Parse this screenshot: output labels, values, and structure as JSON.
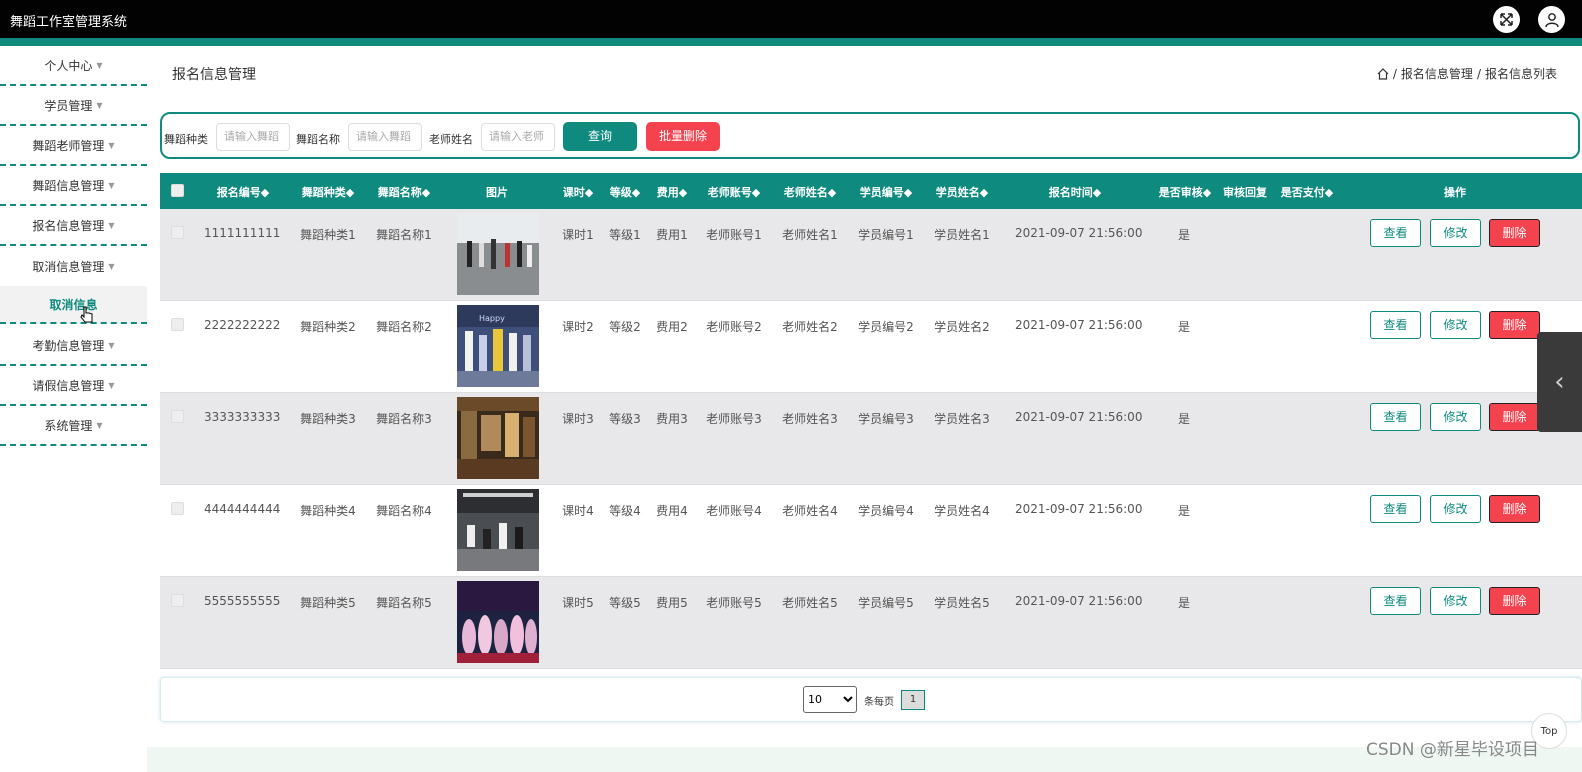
{
  "app": {
    "title": "舞蹈工作室管理系统"
  },
  "sidebar": {
    "items": [
      {
        "label": "个人中心"
      },
      {
        "label": "学员管理"
      },
      {
        "label": "舞蹈老师管理"
      },
      {
        "label": "舞蹈信息管理"
      },
      {
        "label": "报名信息管理"
      },
      {
        "label": "取消信息管理"
      },
      {
        "label": "考勤信息管理"
      },
      {
        "label": "请假信息管理"
      },
      {
        "label": "系统管理"
      }
    ],
    "sub_item": {
      "label": "取消信息"
    }
  },
  "header": {
    "page_title": "报名信息管理",
    "breadcrumb": [
      "报名信息管理",
      "报名信息列表"
    ],
    "separator": "/"
  },
  "search": {
    "fields": [
      {
        "label": "舞蹈种类",
        "placeholder": "请输入舞蹈"
      },
      {
        "label": "舞蹈名称",
        "placeholder": "请输入舞蹈"
      },
      {
        "label": "老师姓名",
        "placeholder": "请输入老师"
      }
    ],
    "query_label": "查询",
    "bulk_delete_label": "批量删除"
  },
  "table": {
    "columns": [
      "报名编号◆",
      "舞蹈种类◆",
      "舞蹈名称◆",
      "图片",
      "课时◆",
      "等级◆",
      "费用◆",
      "老师账号◆",
      "老师姓名◆",
      "学员编号◆",
      "学员姓名◆",
      "报名时间◆",
      "是否审核◆",
      "审核回复",
      "是否支付◆",
      "操作"
    ],
    "rows": [
      {
        "id": "1111111111",
        "kind": "舞蹈种类1",
        "name": "舞蹈名称1",
        "hours": "课时1",
        "level": "等级1",
        "fee": "费用1",
        "teacher_account": "老师账号1",
        "teacher_name": "老师姓名1",
        "student_no": "学员编号1",
        "student_name": "学员姓名1",
        "time": "2021-09-07 21:56:00",
        "reviewed": "是",
        "reply": "",
        "paid": ""
      },
      {
        "id": "2222222222",
        "kind": "舞蹈种类2",
        "name": "舞蹈名称2",
        "hours": "课时2",
        "level": "等级2",
        "fee": "费用2",
        "teacher_account": "老师账号2",
        "teacher_name": "老师姓名2",
        "student_no": "学员编号2",
        "student_name": "学员姓名2",
        "time": "2021-09-07 21:56:00",
        "reviewed": "是",
        "reply": "",
        "paid": ""
      },
      {
        "id": "3333333333",
        "kind": "舞蹈种类3",
        "name": "舞蹈名称3",
        "hours": "课时3",
        "level": "等级3",
        "fee": "费用3",
        "teacher_account": "老师账号3",
        "teacher_name": "老师姓名3",
        "student_no": "学员编号3",
        "student_name": "学员姓名3",
        "time": "2021-09-07 21:56:00",
        "reviewed": "是",
        "reply": "",
        "paid": ""
      },
      {
        "id": "4444444444",
        "kind": "舞蹈种类4",
        "name": "舞蹈名称4",
        "hours": "课时4",
        "level": "等级4",
        "fee": "费用4",
        "teacher_account": "老师账号4",
        "teacher_name": "老师姓名4",
        "student_no": "学员编号4",
        "student_name": "学员姓名4",
        "time": "2021-09-07 21:56:00",
        "reviewed": "是",
        "reply": "",
        "paid": ""
      },
      {
        "id": "5555555555",
        "kind": "舞蹈种类5",
        "name": "舞蹈名称5",
        "hours": "课时5",
        "level": "等级5",
        "fee": "费用5",
        "teacher_account": "老师账号5",
        "teacher_name": "老师姓名5",
        "student_no": "学员编号5",
        "student_name": "学员姓名5",
        "time": "2021-09-07 21:56:00",
        "reviewed": "是",
        "reply": "",
        "paid": ""
      }
    ],
    "actions": {
      "view": "查看",
      "edit": "修改",
      "delete": "删除"
    }
  },
  "pagination": {
    "page_size": "10",
    "per_page_label": "条每页",
    "current_page": "1"
  },
  "floating": {
    "top_label": "Top"
  },
  "watermark": "CSDN @新星毕设项目",
  "colors": {
    "accent": "#0f8a7e",
    "danger": "#f4424e",
    "topbar": "#020202"
  },
  "icons": [
    "fullscreen-icon",
    "user-icon",
    "home-icon",
    "chevron-left-icon"
  ]
}
